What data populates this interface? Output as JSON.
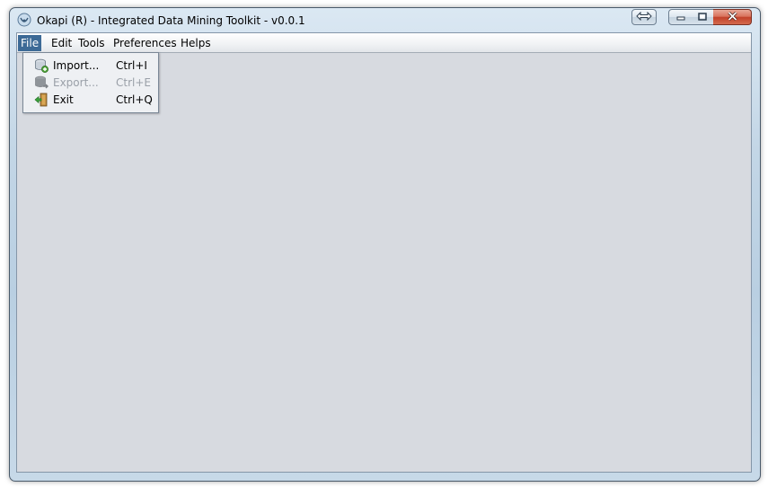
{
  "window": {
    "title": "Okapi (R) - Integrated Data Mining Toolkit - v0.0.1"
  },
  "menubar": {
    "items": [
      {
        "label": "File",
        "active": true
      },
      {
        "label": "Edit"
      },
      {
        "label": "Tools"
      },
      {
        "label": "Preferences"
      },
      {
        "label": "Helps"
      }
    ]
  },
  "file_menu": {
    "items": [
      {
        "label": "Import...",
        "accelerator": "Ctrl+I",
        "icon": "database-add-icon",
        "enabled": true
      },
      {
        "label": "Export...",
        "accelerator": "Ctrl+E",
        "icon": "database-export-icon",
        "enabled": false
      },
      {
        "label": "Exit",
        "accelerator": "Ctrl+Q",
        "icon": "exit-door-icon",
        "enabled": true
      }
    ]
  },
  "colors": {
    "menu_highlight": "#3d6a96",
    "client_background": "#d7dae0",
    "disabled_text": "#9aa0a8"
  }
}
